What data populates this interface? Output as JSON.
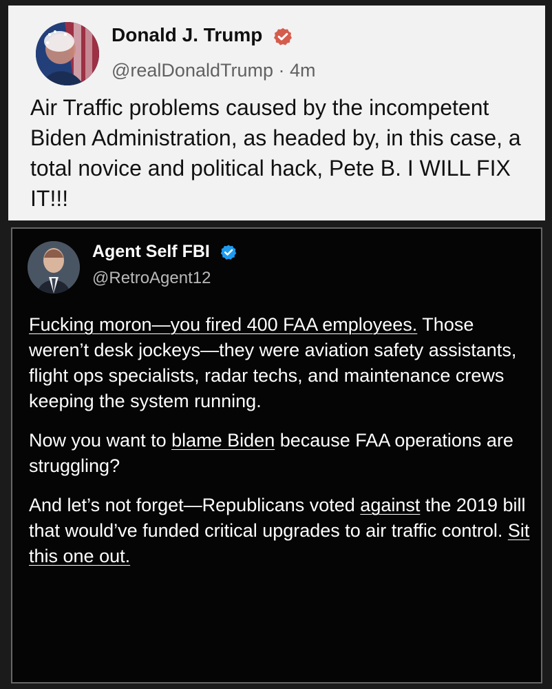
{
  "top_post": {
    "avatar_icon": "american-flag-portrait-avatar",
    "name": "Donald J. Trump",
    "verified_icon": "verified-badge-icon",
    "handle": "@realDonaldTrump",
    "separator": "·",
    "time": "4m",
    "text": "Air Traffic problems caused by the incompetent Biden Administration, as headed by, in this case, a total novice and political hack, Pete B. I WILL FIX IT!!!"
  },
  "bottom_post": {
    "avatar_icon": "man-in-suit-avatar",
    "name": "Agent Self FBI",
    "verified_icon": "verified-badge-icon",
    "handle": "@RetroAgent12",
    "paragraph_1": {
      "lead": "Fucking moron—you fired 400 FAA employees.",
      "rest": " Those weren’t desk jockeys—they were aviation safety assistants, flight ops specialists, radar techs, and maintenance crews keeping the system running."
    },
    "paragraph_2": {
      "before": "Now you want to ",
      "underlined": "blame Biden",
      "after": " because FAA operations are struggling?"
    },
    "paragraph_3": {
      "before": "And let’s not forget—Republicans voted ",
      "underlined_1": "against",
      "middle": " the 2019 bill that would’ve funded critical upgrades to air traffic control. ",
      "underlined_2": "Sit this one out."
    }
  },
  "colors": {
    "top_background": "#f2f2f2",
    "bottom_background": "#050505",
    "verified_orange": "#d55c4d",
    "verified_blue": "#1d9bf0"
  }
}
